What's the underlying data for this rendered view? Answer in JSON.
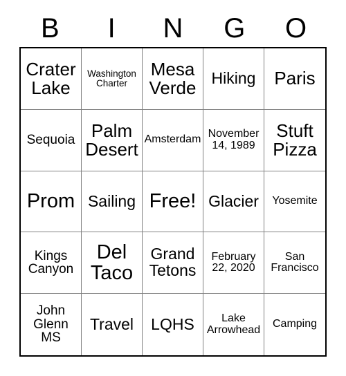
{
  "card": {
    "title_letters": [
      "B",
      "I",
      "N",
      "G",
      "O"
    ],
    "columns": 5,
    "rows": 5,
    "border_color": "#000000",
    "gridline_color": "#808080",
    "background_color": "#ffffff",
    "text_color": "#000000",
    "free_space": {
      "label": "Free!",
      "row": 3,
      "column": 3
    },
    "cells": [
      {
        "text": "Crater Lake",
        "size": "lg"
      },
      {
        "text": "Washington Charter",
        "size": "xxs"
      },
      {
        "text": "Mesa Verde",
        "size": "lg"
      },
      {
        "text": "Hiking",
        "size": "md"
      },
      {
        "text": "Paris",
        "size": "lg"
      },
      {
        "text": "Sequoia",
        "size": "sm"
      },
      {
        "text": "Palm Desert",
        "size": "lg"
      },
      {
        "text": "Amsterdam",
        "size": "xs"
      },
      {
        "text": "November 14, 1989",
        "size": "xs"
      },
      {
        "text": "Stuft Pizza",
        "size": "lg"
      },
      {
        "text": "Prom",
        "size": "xl"
      },
      {
        "text": "Sailing",
        "size": "md"
      },
      {
        "text": "Free!",
        "size": "xl"
      },
      {
        "text": "Glacier",
        "size": "md"
      },
      {
        "text": "Yosemite",
        "size": "xs"
      },
      {
        "text": "Kings Canyon",
        "size": "sm"
      },
      {
        "text": "Del Taco",
        "size": "xl"
      },
      {
        "text": "Grand Tetons",
        "size": "md"
      },
      {
        "text": "February 22, 2020",
        "size": "xs"
      },
      {
        "text": "San Francisco",
        "size": "xs"
      },
      {
        "text": "John Glenn MS",
        "size": "sm"
      },
      {
        "text": "Travel",
        "size": "md"
      },
      {
        "text": "LQHS",
        "size": "md"
      },
      {
        "text": "Lake Arrowhead",
        "size": "xs"
      },
      {
        "text": "Camping",
        "size": "xs"
      }
    ]
  }
}
